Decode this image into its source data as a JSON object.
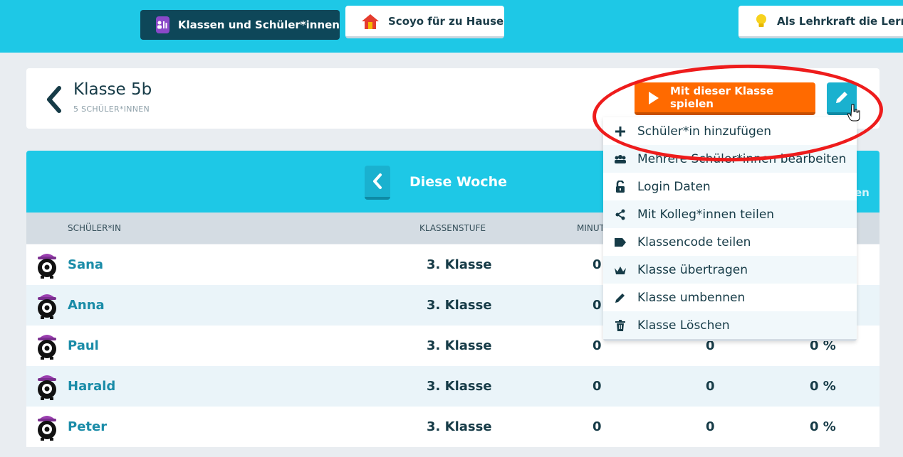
{
  "topbar": {
    "tabs": [
      {
        "label": "Klassen und Schüler*innen",
        "active": true
      },
      {
        "label": "Scoyo für zu Hause"
      },
      {
        "label": "Als Lehrkraft die Lernwe"
      }
    ]
  },
  "header": {
    "title": "Klasse 5b",
    "subtitle": "5 SCHÜLER*INNEN",
    "play_label": "Mit dieser Klasse spielen"
  },
  "table": {
    "period_label": "Diese Woche",
    "peek_text": "en",
    "columns": [
      "SCHÜLER*IN",
      "KLASSENSTUFE",
      "MINUT"
    ],
    "rows": [
      {
        "name": "Sana",
        "grade": "3. Klasse",
        "minutes": "0",
        "col2": "",
        "col3": ""
      },
      {
        "name": "Anna",
        "grade": "3. Klasse",
        "minutes": "0",
        "col2": "",
        "col3": ""
      },
      {
        "name": "Paul",
        "grade": "3. Klasse",
        "minutes": "0",
        "col2": "0",
        "col3": "0 %"
      },
      {
        "name": "Harald",
        "grade": "3. Klasse",
        "minutes": "0",
        "col2": "0",
        "col3": "0 %"
      },
      {
        "name": "Peter",
        "grade": "3. Klasse",
        "minutes": "0",
        "col2": "0",
        "col3": "0 %"
      }
    ]
  },
  "menu": {
    "items": [
      {
        "label": "Schüler*in hinzufügen",
        "icon": "plus-icon"
      },
      {
        "label": "Mehrere Schüler*innen bearbeiten",
        "icon": "group-icon"
      },
      {
        "label": "Login Daten",
        "icon": "unlock-icon"
      },
      {
        "label": "Mit Kolleg*innen teilen",
        "icon": "share-icon"
      },
      {
        "label": "Klassencode teilen",
        "icon": "tag-icon"
      },
      {
        "label": "Klasse übertragen",
        "icon": "crown-icon"
      },
      {
        "label": "Klasse umbennen",
        "icon": "pencil-icon"
      },
      {
        "label": "Klasse Löschen",
        "icon": "trash-icon"
      }
    ]
  },
  "colors": {
    "accent": "#1ec8e6",
    "primary_dark": "#0e4759",
    "play_orange": "#ff6a00",
    "annotation_red": "#ee1c1c"
  }
}
